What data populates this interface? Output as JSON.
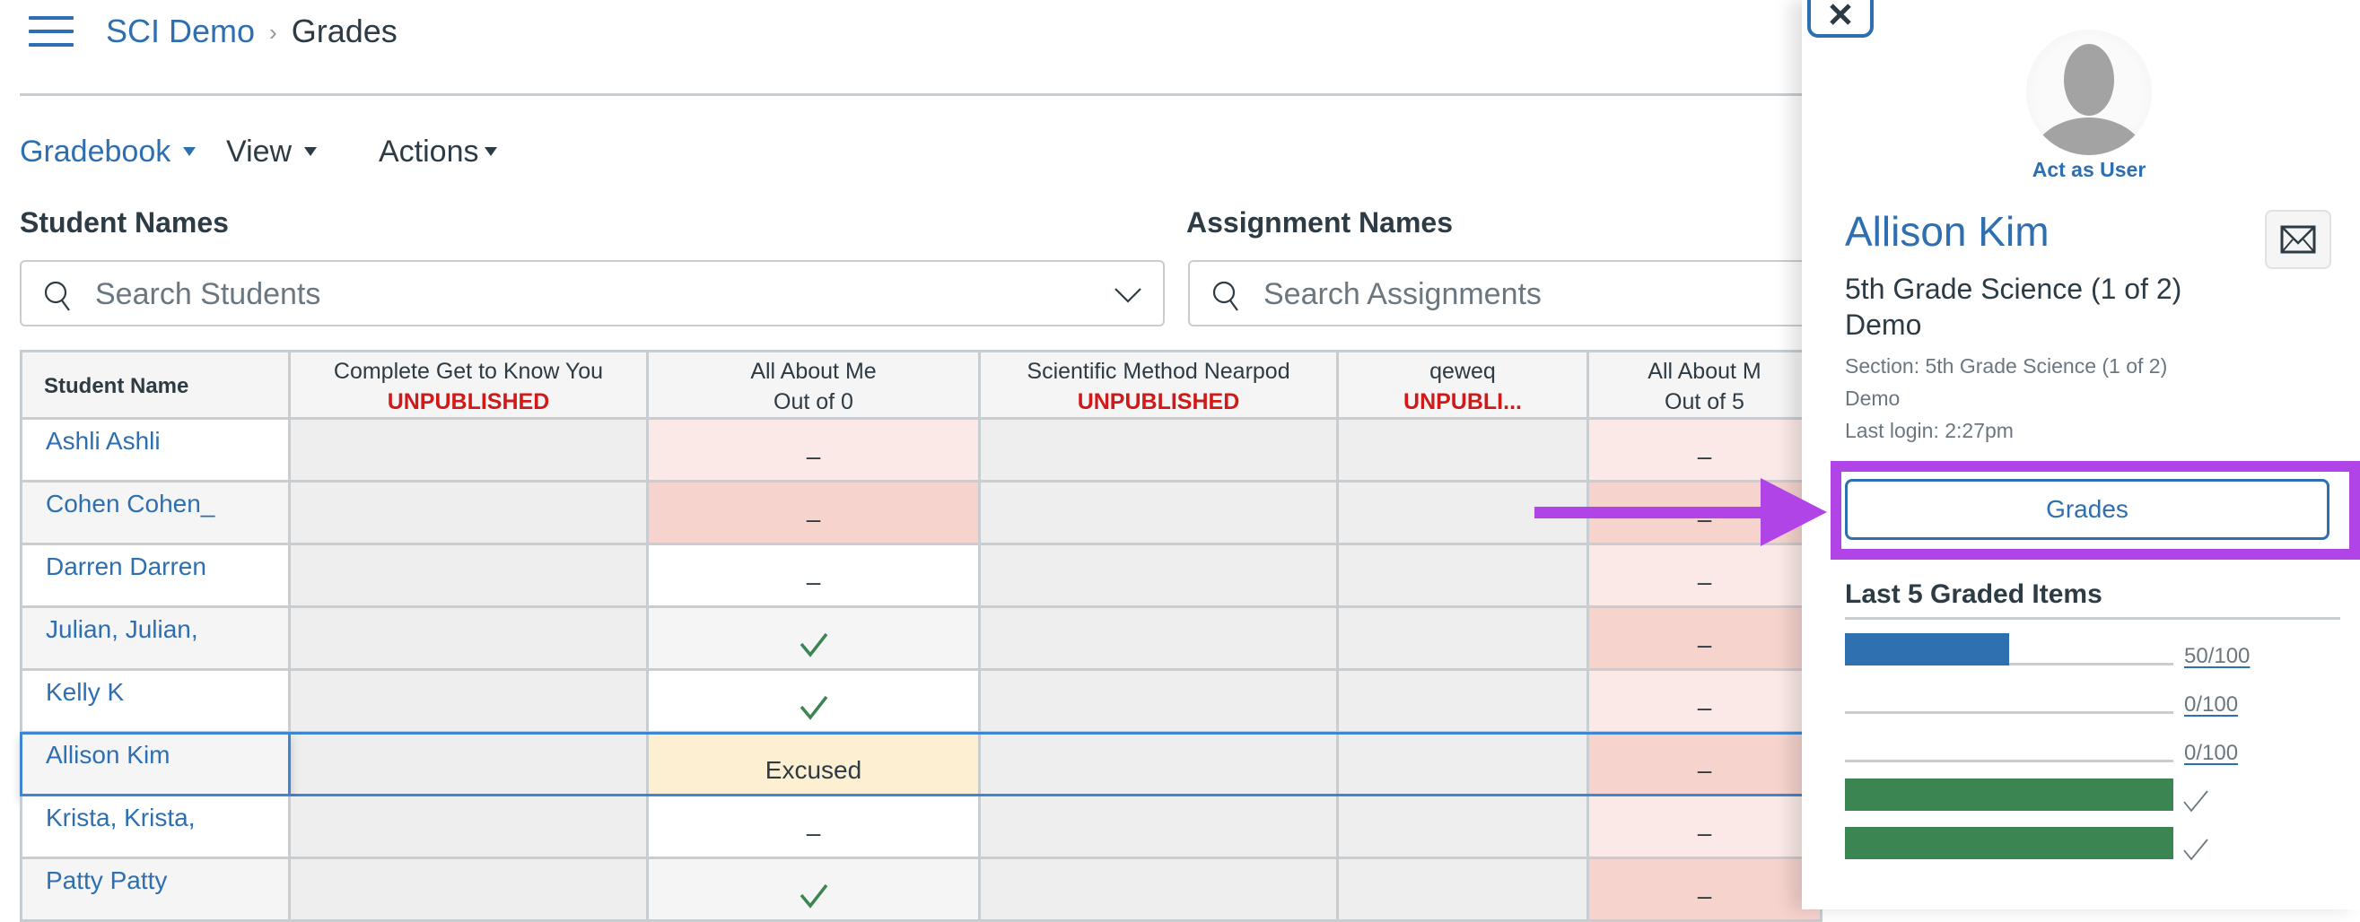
{
  "header": {
    "breadcrumb": [
      {
        "label": "SCI Demo",
        "link": true
      },
      {
        "label": "Grades",
        "link": false
      }
    ],
    "separator": "›"
  },
  "toolbar": {
    "gradebook_label": "Gradebook",
    "view_label": "View",
    "actions_label": "Actions"
  },
  "filters": {
    "students_label": "Student Names",
    "students_placeholder": "Search Students",
    "assignments_label": "Assignment Names",
    "assignments_placeholder": "Search Assignments"
  },
  "gradebook": {
    "name_header": "Student Name",
    "columns": [
      {
        "title": "Complete Get to Know You",
        "subtitle": "UNPUBLISHED",
        "unpublished": true
      },
      {
        "title": "All About Me",
        "subtitle": "Out of 0",
        "unpublished": false
      },
      {
        "title": "Scientific Method Nearpod",
        "subtitle": "UNPUBLISHED",
        "unpublished": true
      },
      {
        "title": "qeweq",
        "subtitle": "UNPUBLI...",
        "unpublished": true
      },
      {
        "title": "All About M",
        "subtitle": "Out of 5",
        "unpublished": false
      }
    ],
    "rows": [
      {
        "name": "Ashli Ashli",
        "cells": [
          "",
          "–",
          "",
          "",
          "–"
        ],
        "status": [
          "",
          "pale",
          "",
          "",
          "pale"
        ]
      },
      {
        "name": "Cohen Cohen_",
        "cells": [
          "",
          "–",
          "",
          "",
          "–"
        ],
        "status": [
          "",
          "deep",
          "",
          "",
          "deep"
        ]
      },
      {
        "name": "Darren Darren",
        "cells": [
          "",
          "–",
          "",
          "",
          "–"
        ],
        "status": [
          "",
          "white",
          "",
          "",
          "pale"
        ]
      },
      {
        "name": "Julian, Julian,",
        "cells": [
          "",
          "check",
          "",
          "",
          "–"
        ],
        "status": [
          "",
          "alt",
          "",
          "",
          "deep"
        ]
      },
      {
        "name": "Kelly K",
        "cells": [
          "",
          "check",
          "",
          "",
          "–"
        ],
        "status": [
          "",
          "white",
          "",
          "",
          "pale"
        ]
      },
      {
        "name": "Allison Kim",
        "cells": [
          "",
          "Excused",
          "",
          "",
          "–"
        ],
        "status": [
          "",
          "excused",
          "",
          "",
          "deep"
        ],
        "selected": true
      },
      {
        "name": "Krista, Krista,",
        "cells": [
          "",
          "–",
          "",
          "",
          "–"
        ],
        "status": [
          "",
          "white",
          "",
          "",
          "pale"
        ]
      },
      {
        "name": "Patty Patty",
        "cells": [
          "",
          "check",
          "",
          "",
          "–"
        ],
        "status": [
          "",
          "alt",
          "",
          "",
          "deep"
        ]
      }
    ]
  },
  "tray": {
    "close_icon": "close-icon",
    "act_as_user": "Act as User",
    "student_name": "Allison Kim",
    "course": "5th Grade Science (1 of 2) Demo",
    "section": "Section: 5th Grade Science (1 of 2)",
    "section_line2": "Demo",
    "last_login": "Last login: 2:27pm",
    "grades_button": "Grades",
    "last5_title": "Last 5 Graded Items",
    "graded_items": [
      {
        "score_label": "50/100",
        "fraction": 0.5,
        "color": "#2f70b0",
        "type": "score"
      },
      {
        "score_label": "0/100",
        "fraction": 0,
        "color": "#2f70b0",
        "type": "score"
      },
      {
        "score_label": "0/100",
        "fraction": 0,
        "color": "#2f70b0",
        "type": "score"
      },
      {
        "score_label": "",
        "fraction": 1,
        "color": "#3b8552",
        "type": "check"
      },
      {
        "score_label": "",
        "fraction": 1,
        "color": "#3b8552",
        "type": "check"
      }
    ]
  },
  "colors": {
    "brand_blue": "#2d6fb0",
    "unpublished_red": "#d01a19",
    "annotation_purple": "#b044e6",
    "check_green": "#3b8552"
  }
}
